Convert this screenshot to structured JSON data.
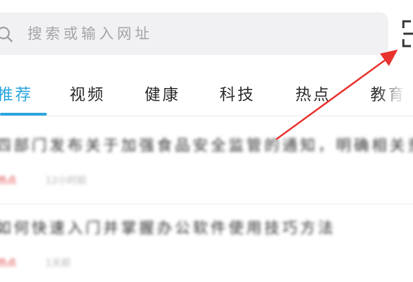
{
  "search": {
    "placeholder": "搜索或输入网址"
  },
  "icons": {
    "search": "search-icon",
    "scan": "scan-icon"
  },
  "tabs": [
    {
      "label": "推荐",
      "active": true
    },
    {
      "label": "视频",
      "active": false
    },
    {
      "label": "健康",
      "active": false
    },
    {
      "label": "科技",
      "active": false
    },
    {
      "label": "热点",
      "active": false
    },
    {
      "label": "教育",
      "active": false
    }
  ],
  "news": [
    {
      "title": "四部门发布关于加强食品安全监管的通知，明确相关责任要求",
      "source": "热点",
      "meta": "12小时前"
    },
    {
      "title": "如何快速入门并掌握办公软件使用技巧方法",
      "source": "热点",
      "meta": "1天前"
    }
  ],
  "colors": {
    "accent": "#2aa5df",
    "annotation": "#e8322d",
    "source_tag": "#e05151"
  }
}
